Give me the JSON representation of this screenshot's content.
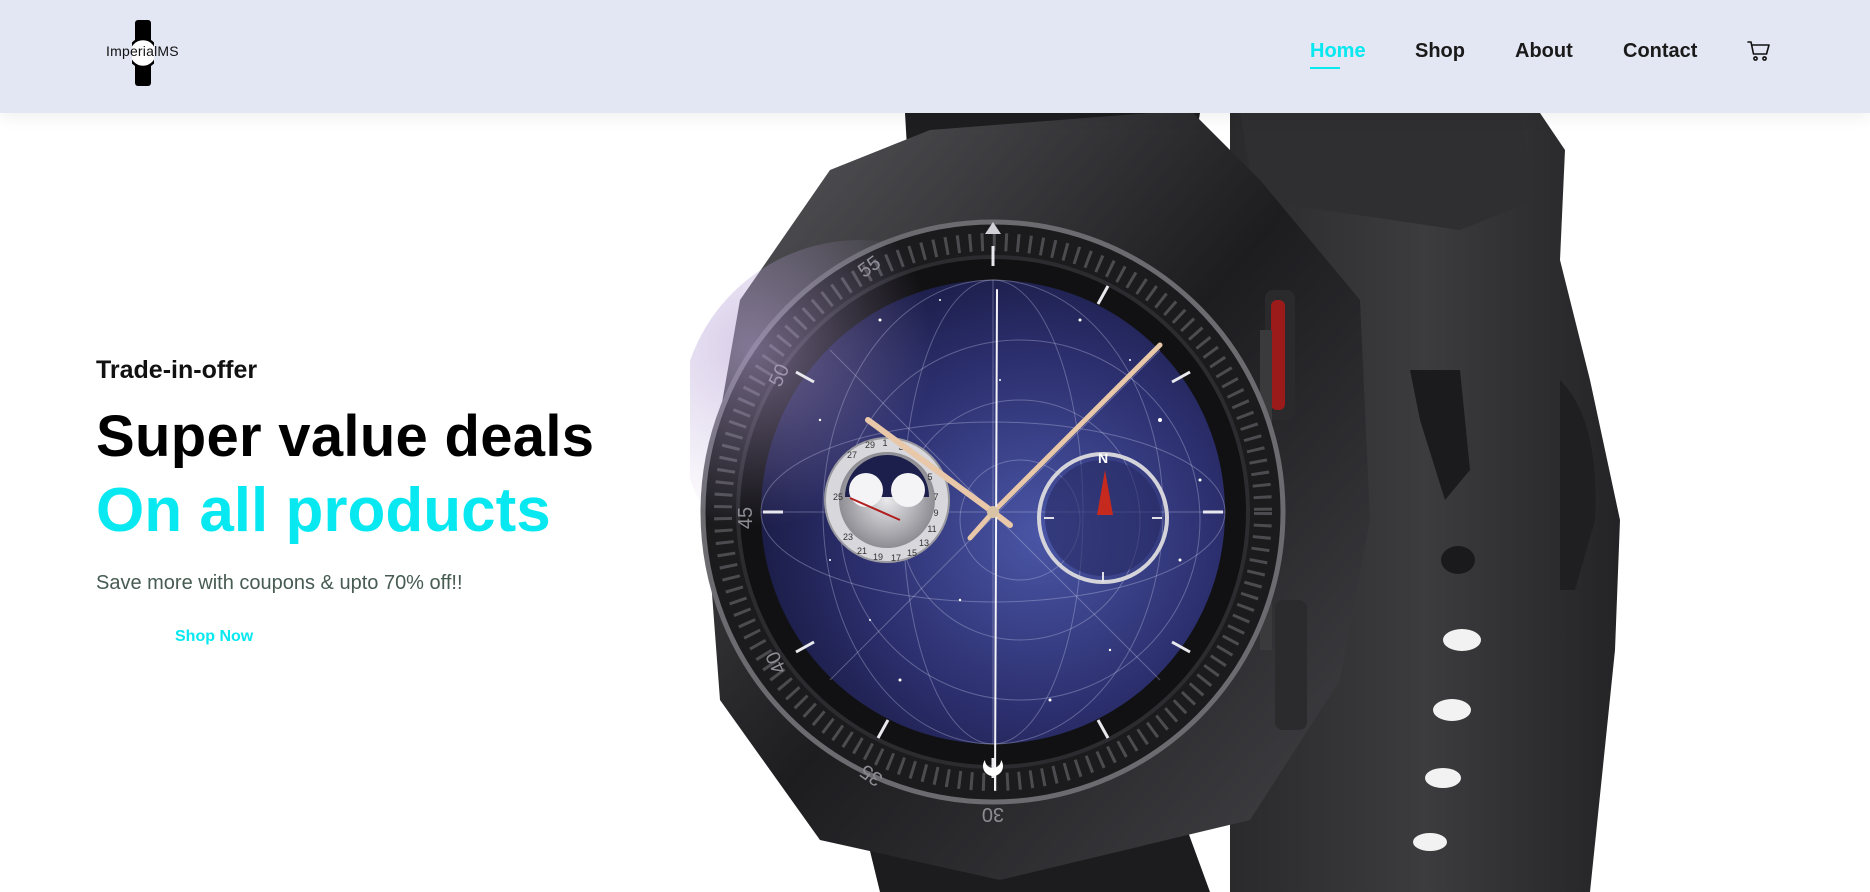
{
  "header": {
    "logo_text": "ImperialMS",
    "logo_icon": "wristwatch-icon",
    "nav": [
      "Home",
      "Shop",
      "About",
      "Contact"
    ],
    "active_nav": "Home",
    "cart_icon": "shopping-cart-icon"
  },
  "hero": {
    "kicker": "Trade-in-offer",
    "headline_line1": "Super value deals",
    "headline_line2": "On all products",
    "subtext": "Save more with coupons & upto 70% off!!",
    "cta_label": "Shop Now",
    "image": "smartwatch-product-image",
    "bezel_numbers": [
      "55",
      "50",
      "45",
      "40",
      "35",
      "30"
    ],
    "moon_dial_numbers": [
      "29",
      "1",
      "27",
      "3",
      "25",
      "5",
      "7",
      "9",
      "11",
      "13",
      "15",
      "17",
      "19",
      "21",
      "23"
    ],
    "compass_letter": "N"
  },
  "colors": {
    "accent": "#08e8f0",
    "header_bg": "#e3e6f3",
    "heading": "#000000",
    "subtext": "#465b52"
  }
}
